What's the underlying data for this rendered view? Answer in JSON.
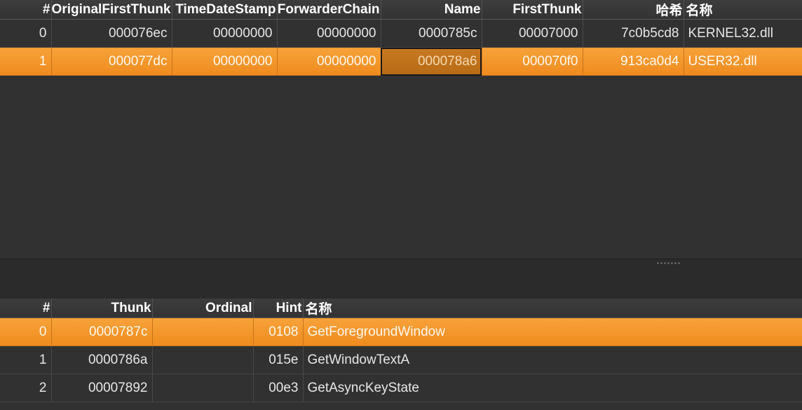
{
  "modules_table": {
    "columns": [
      "#",
      "OriginalFirstThunk",
      "TimeDateStamp",
      "ForwarderChain",
      "Name",
      "FirstThunk",
      "哈希",
      "名称"
    ],
    "rows": [
      [
        "0",
        "000076ec",
        "00000000",
        "00000000",
        "0000785c",
        "00007000",
        "7c0b5cd8",
        "KERNEL32.dll"
      ],
      [
        "1",
        "000077dc",
        "00000000",
        "00000000",
        "000078a6",
        "000070f0",
        "913ca0d4",
        "USER32.dll"
      ]
    ],
    "selected_row": 1
  },
  "functions_table": {
    "columns": [
      "#",
      "Thunk",
      "Ordinal",
      "Hint",
      "名称"
    ],
    "rows": [
      [
        "0",
        "0000787c",
        "",
        "0108",
        "GetForegroundWindow"
      ],
      [
        "1",
        "0000786a",
        "",
        "015e",
        "GetWindowTextA"
      ],
      [
        "2",
        "00007892",
        "",
        "00e3",
        "GetAsyncKeyState"
      ]
    ],
    "selected_row": 0
  },
  "colors": {
    "selection": "#f39a2c",
    "background": "#313131",
    "header_text": "#ffffff"
  }
}
